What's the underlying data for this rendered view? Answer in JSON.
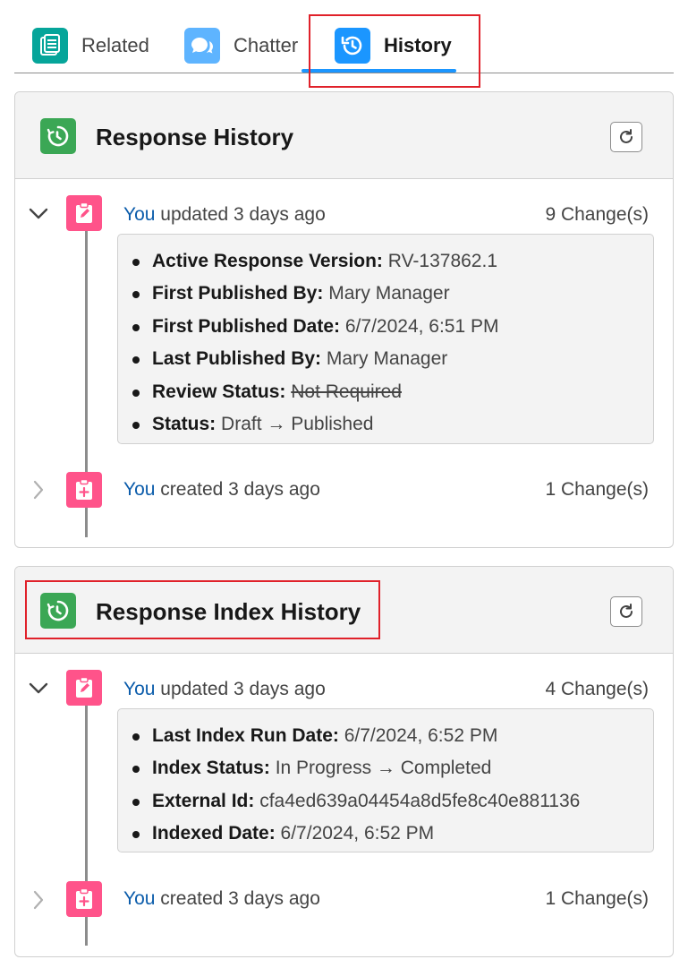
{
  "tabs": {
    "related": "Related",
    "chatter": "Chatter",
    "history": "History"
  },
  "colors": {
    "related_icon": "#06a59a",
    "chatter_icon": "#5eb4ff",
    "history_icon": "#1b96ff",
    "card_icon": "#3ba755",
    "timeline_icon": "#ff538a",
    "highlight": "#e0212a",
    "link": "#0b5cab"
  },
  "icons": {
    "related": "related-list-icon",
    "chatter": "chatter-bubbles-icon",
    "history": "history-clock-icon",
    "card": "clock-history-icon",
    "refresh": "refresh-icon",
    "updated": "edit-clipboard-icon",
    "created": "add-clipboard-icon"
  },
  "response_history": {
    "title": "Response History",
    "updated_entry": {
      "actor": "You",
      "action": " updated 3 days ago",
      "count": "9 Change(s)",
      "changes": [
        {
          "label": "Active Response Version:",
          "value": "RV-137862.1"
        },
        {
          "label": "First Published By:",
          "value": "Mary Manager"
        },
        {
          "label": "First Published Date:",
          "value": "6/7/2024, 6:51 PM"
        },
        {
          "label": "Last Published By:",
          "value": "Mary Manager"
        },
        {
          "label": "Review Status:",
          "value": "Not Required"
        },
        {
          "label": "Status:",
          "value": "Draft → Published"
        }
      ]
    },
    "created_entry": {
      "actor": "You",
      "action": " created 3 days ago",
      "count": "1 Change(s)"
    }
  },
  "response_index_history": {
    "title": "Response Index History",
    "updated_entry": {
      "actor": "You",
      "action": " updated 3 days ago",
      "count": "4 Change(s)",
      "changes": [
        {
          "label": "Last Index Run Date:",
          "value": "6/7/2024, 6:52 PM"
        },
        {
          "label": "Index Status:",
          "value": "In Progress → Completed"
        },
        {
          "label": "External Id:",
          "value": "cfa4ed639a04454a8d5fe8c40e881136"
        },
        {
          "label": "Indexed Date:",
          "value": "6/7/2024, 6:52 PM"
        }
      ]
    },
    "created_entry": {
      "actor": "You",
      "action": " created 3 days ago",
      "count": "1 Change(s)"
    }
  }
}
